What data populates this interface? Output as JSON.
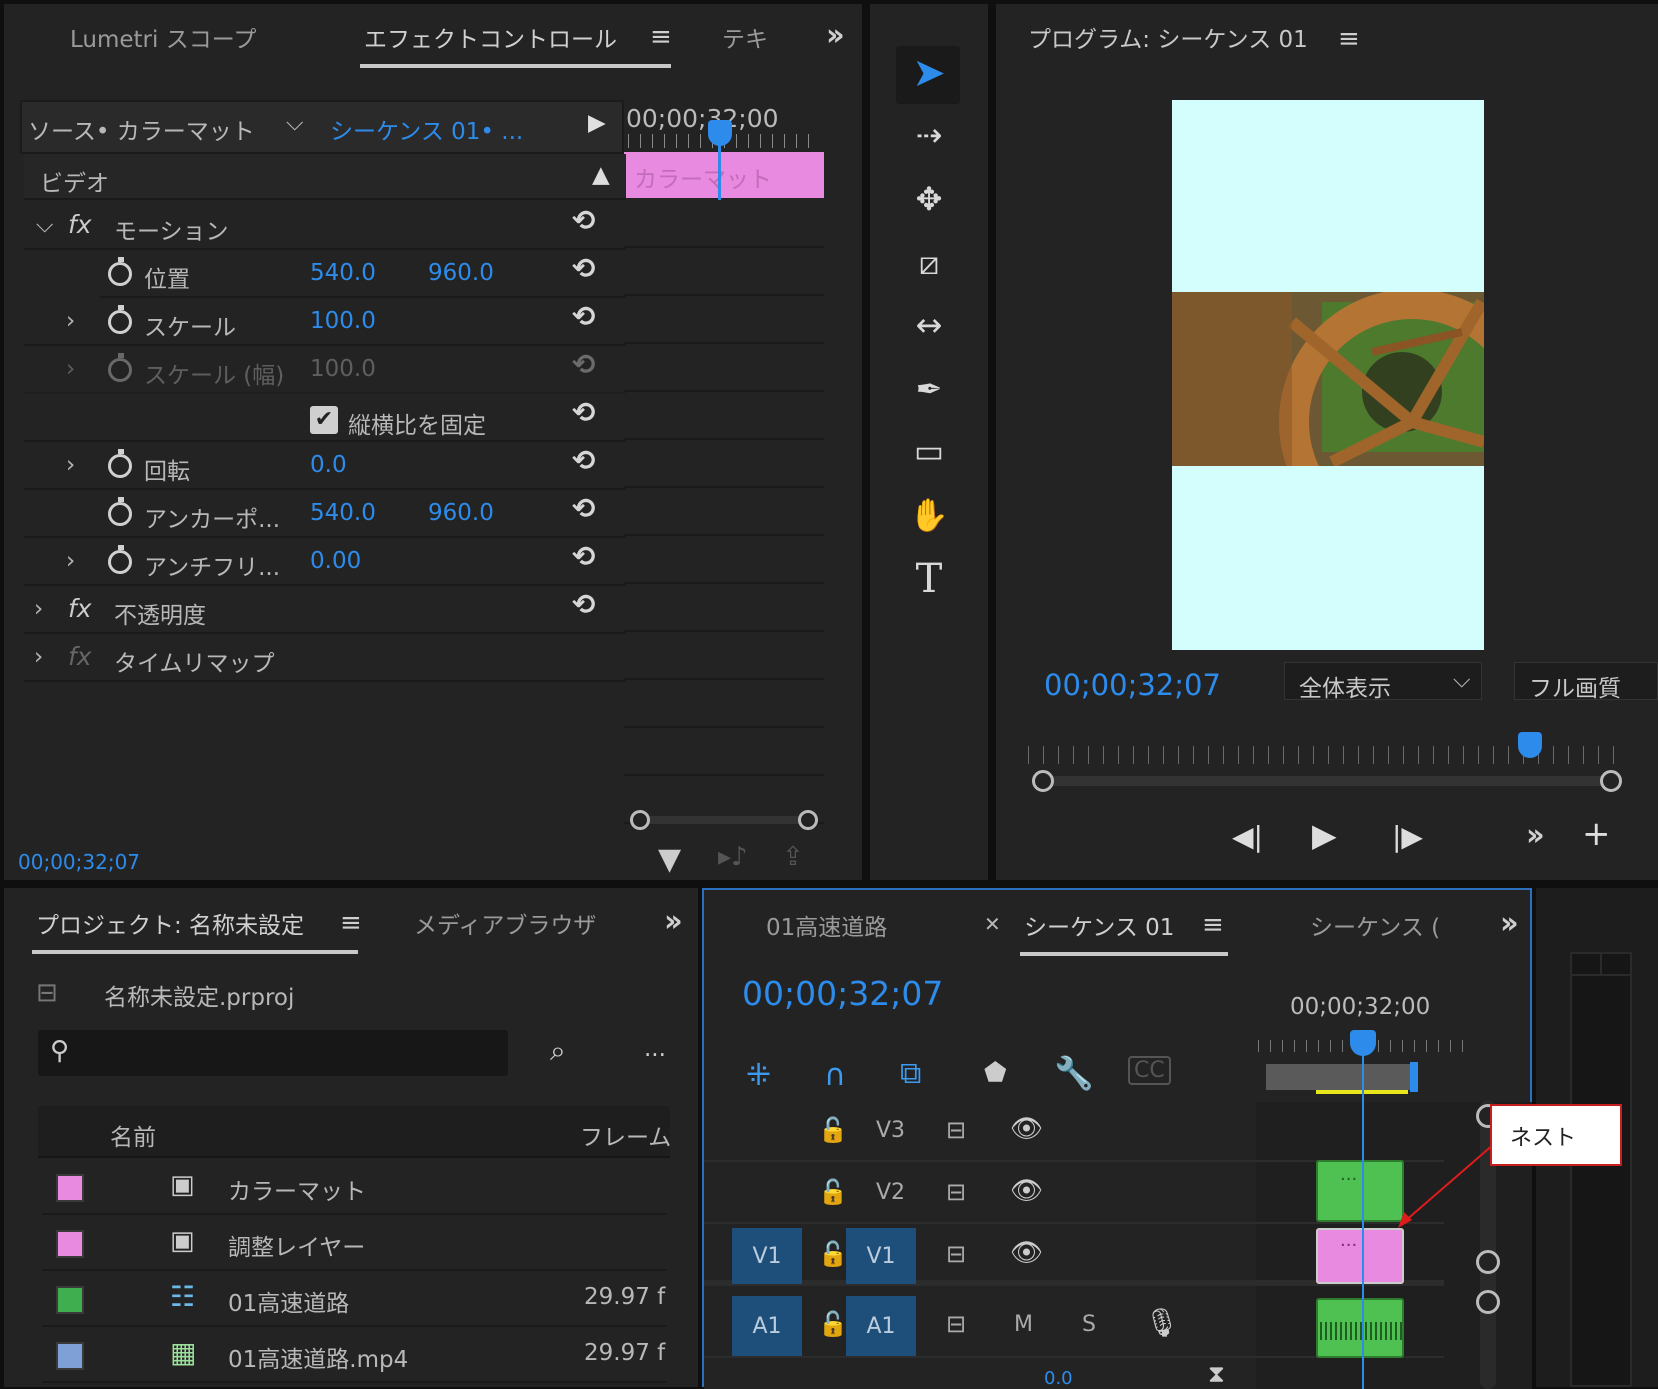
{
  "effect_panel": {
    "tabs": [
      "Lumetri スコープ",
      "エフェクトコントロール",
      "テキ"
    ],
    "source_label": "ソース• カラーマット",
    "sequence_link": "シーケンス 01• ...",
    "timecode_ruler": "00;00;32;00",
    "clip_label": "カラーマット",
    "video_header": "ビデオ",
    "motion": "モーション",
    "rows": [
      {
        "label": "位置",
        "v1": "540.0",
        "v2": "960.0"
      },
      {
        "label": "スケール",
        "v1": "100.0",
        "v2": ""
      },
      {
        "label": "スケール (幅)",
        "v1": "100.0",
        "v2": ""
      },
      {
        "label": "縦横比を固定",
        "v1": "",
        "v2": ""
      },
      {
        "label": "回転",
        "v1": "0.0",
        "v2": ""
      },
      {
        "label": "アンカーポ...",
        "v1": "540.0",
        "v2": "960.0"
      },
      {
        "label": "アンチフリ...",
        "v1": "0.00",
        "v2": ""
      }
    ],
    "opacity": "不透明度",
    "time_remap": "タイムリマップ",
    "timecode": "00;00;32;07"
  },
  "program": {
    "title": "プログラム: シーケンス 01",
    "timecode": "00;00;32;07",
    "zoom": "全体表示",
    "quality": "フル画質",
    "frame_bg": "#d4fdfd"
  },
  "project": {
    "title": "プロジェクト: 名称未設定",
    "tab2": "メディアブラウザ",
    "file": "名称未設定.prproj",
    "col_name": "名前",
    "col_frame": "フレーム",
    "items": [
      {
        "name": "カラーマット",
        "fr": "",
        "color": "#e88ae0"
      },
      {
        "name": "調整レイヤー",
        "fr": "",
        "color": "#e88ae0"
      },
      {
        "name": "01高速道路",
        "fr": "29.97 f",
        "color": "#3fae4f"
      },
      {
        "name": "01高速道路.mp4",
        "fr": "29.97 f",
        "color": "#7ea0d6"
      }
    ]
  },
  "timeline": {
    "tabs": [
      "01高速道路",
      "シーケンス 01",
      "シーケンス ("
    ],
    "timecode": "00;00;32;07",
    "ruler": "00;00;32;00",
    "tracks": {
      "v3": "V3",
      "v2": "V2",
      "v1": "V1",
      "a1": "A1",
      "m": "M",
      "s": "S"
    },
    "clip_dots": "...",
    "volume": "0.0"
  },
  "callout": {
    "text": "ネスト"
  }
}
